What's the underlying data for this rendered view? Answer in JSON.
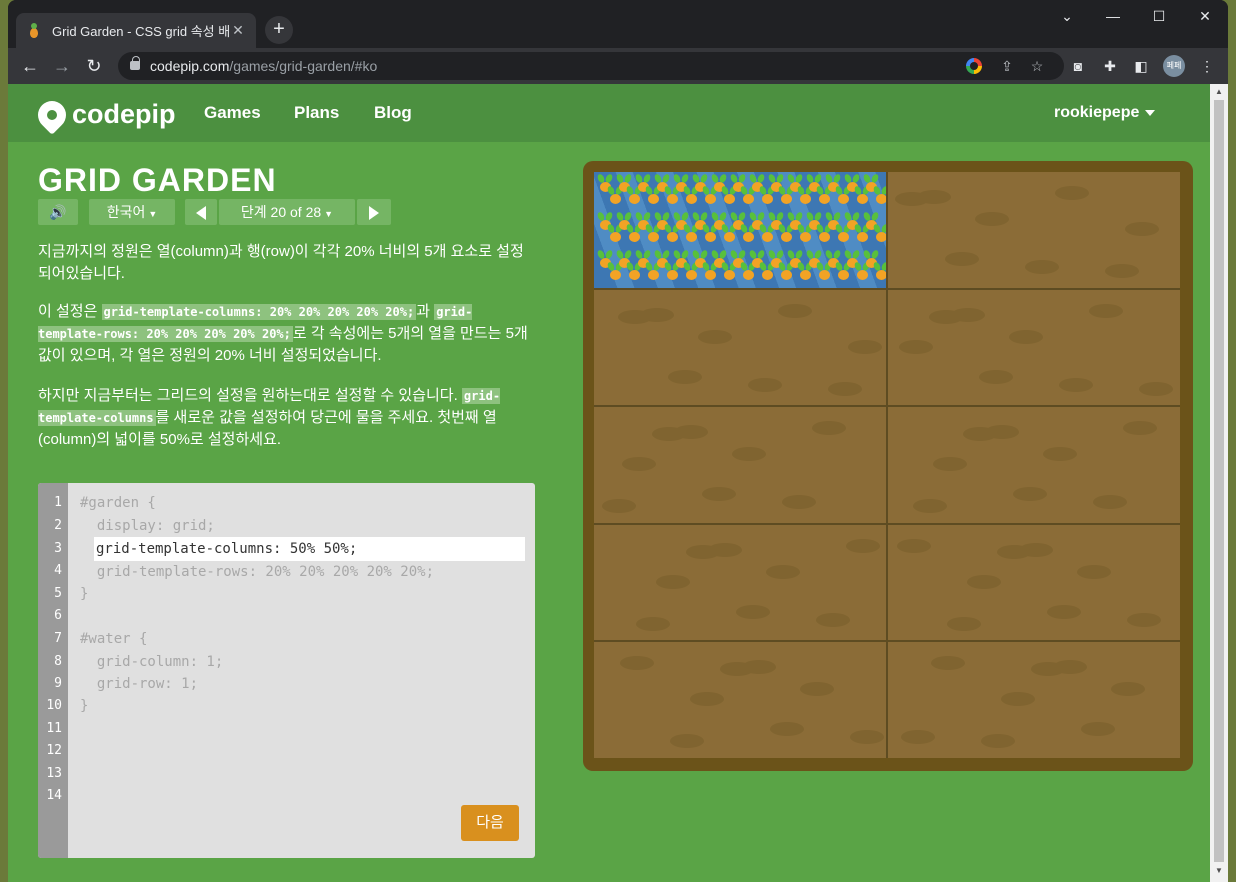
{
  "browser": {
    "tab_title": "Grid Garden - CSS grid 속성 배우기",
    "tab_close": "✕",
    "new_tab": "+",
    "url_host": "codepip.com",
    "url_path": "/games/grid-garden/#ko",
    "profile_initials": "페페",
    "window_controls": [
      "⌄",
      "—",
      "☐",
      "✕"
    ]
  },
  "site": {
    "logo_text": "codepip",
    "nav": [
      "Games",
      "Plans",
      "Blog"
    ],
    "user": "rookiepepe"
  },
  "game": {
    "title": "GRID GARDEN",
    "language": "한국어",
    "level_label": "단계 20 of 28",
    "instructions": {
      "p1": "지금까지의 정원은 열(column)과 행(row)이 각각 20% 너비의 5개 요소로 설정되어있습니다.",
      "p2_a": "이 설정은 ",
      "p2_code1": "grid-template-columns: 20% 20% 20% 20% 20%;",
      "p2_b": "과 ",
      "p2_code2": "grid-template-rows: 20% 20% 20% 20% 20%;",
      "p2_c": "로 각 속성에는 5개의 열을 만드는 5개 값이 있으며, 각 열은 정원의 20% 너비 설정되었습니다.",
      "p3_a": "하지만 지금부터는 그리드의 설정을 원하는대로 설정할 수 있습니다. ",
      "p3_code": "grid-template-columns",
      "p3_b": "를 새로운 값을 설정하여 당근에 물을 주세요. 첫번째 열(column)의 넓이를 50%로 설정하세요."
    },
    "editor": {
      "line_numbers": [
        "1",
        "2",
        "3",
        "4",
        "5",
        "6",
        "7",
        "8",
        "9",
        "10",
        "11",
        "12",
        "13",
        "14"
      ],
      "line1": "#garden {",
      "line2": "  display: grid;",
      "input_value": "grid-template-columns: 50% 50%;",
      "line4": "  grid-template-rows: 20% 20% 20% 20% 20%;",
      "line5": "}",
      "line7": "#water {",
      "line8": "  grid-column: 1;",
      "line9": "  grid-row: 1;",
      "line10": "}",
      "next_button": "다음"
    }
  },
  "colors": {
    "page_bg": "#5aa446",
    "header_bg": "#4c9040",
    "soil": "#8b6c37",
    "frame": "#6b5319",
    "water": "#3d77b3",
    "next_button": "#d9901e"
  }
}
